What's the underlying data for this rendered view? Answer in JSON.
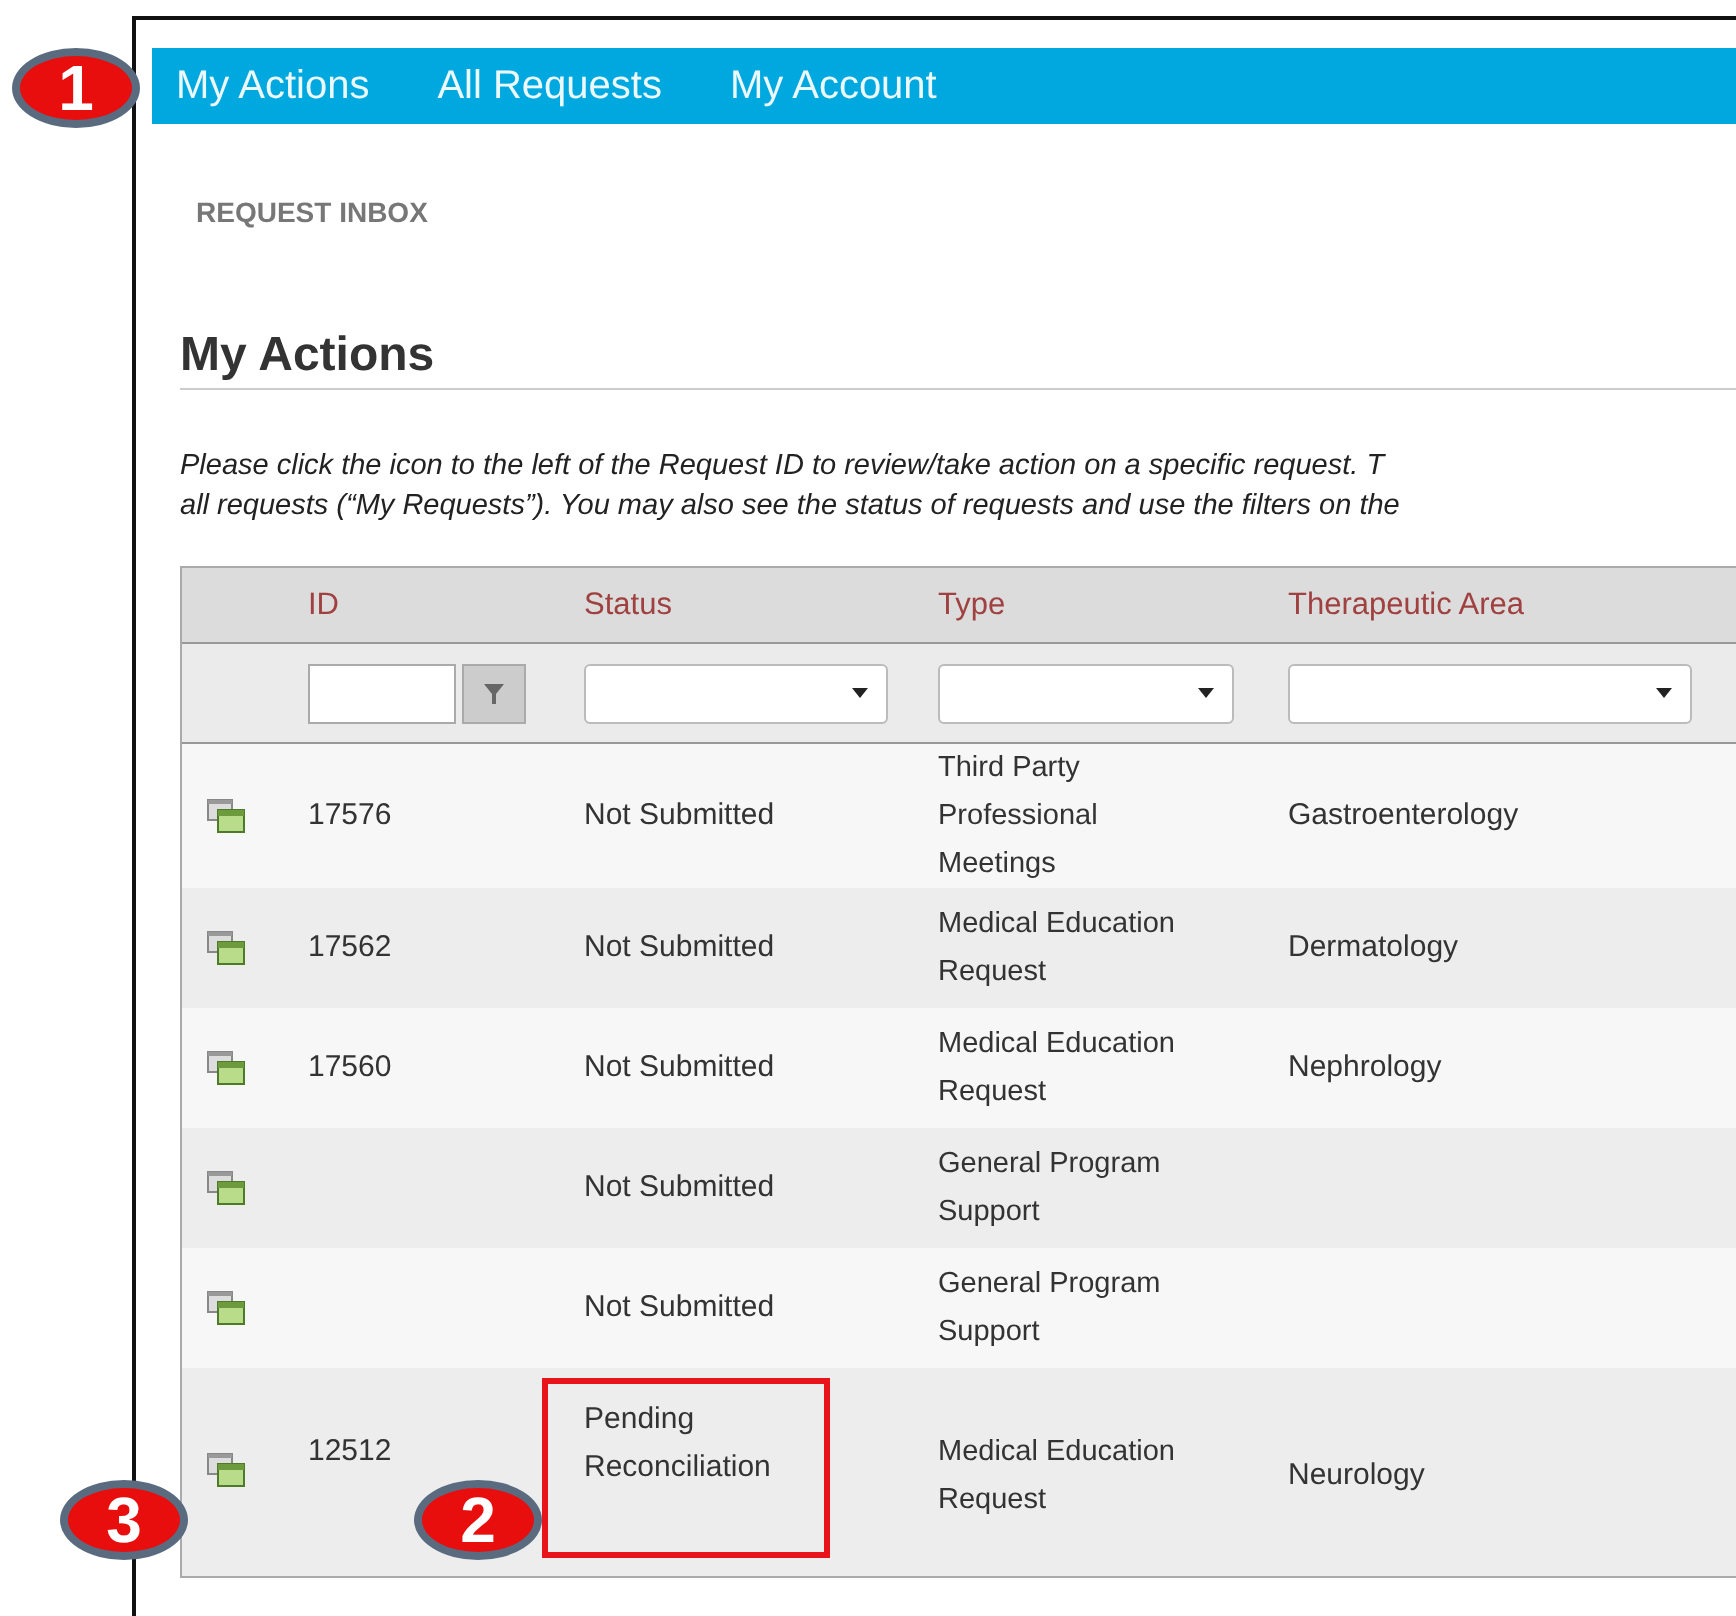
{
  "nav": [
    {
      "label": "My Actions"
    },
    {
      "label": "All Requests"
    },
    {
      "label": "My Account"
    }
  ],
  "breadcrumb": "REQUEST INBOX",
  "heading": "My Actions",
  "instructions": [
    "Please click the icon to the left of the Request ID to review/take action on a specific request. T",
    "all requests (“My Requests”). You may also see the status of requests and use the filters on the"
  ],
  "table": {
    "columns": [
      "ID",
      "Status",
      "Type",
      "Therapeutic Area"
    ],
    "rows": [
      {
        "id": "17576",
        "status": "Not Submitted",
        "type": "Third Party Professional Meetings",
        "area": "Gastroenterology",
        "highlighted": false
      },
      {
        "id": "17562",
        "status": "Not Submitted",
        "type": "Medical Education Request",
        "area": "Dermatology",
        "highlighted": false
      },
      {
        "id": "17560",
        "status": "Not Submitted",
        "type": "Medical Education Request",
        "area": "Nephrology",
        "highlighted": false
      },
      {
        "id": "",
        "status": "Not Submitted",
        "type": "General Program Support",
        "area": "",
        "highlighted": false
      },
      {
        "id": "",
        "status": "Not Submitted",
        "type": "General Program Support",
        "area": "",
        "highlighted": false
      },
      {
        "id": "12512",
        "status": "Pending Reconciliation",
        "type": "Medical Education Request",
        "area": "Neurology",
        "highlighted": true
      }
    ]
  },
  "callouts": [
    {
      "number": "1"
    },
    {
      "number": "3"
    },
    {
      "number": "2"
    }
  ]
}
